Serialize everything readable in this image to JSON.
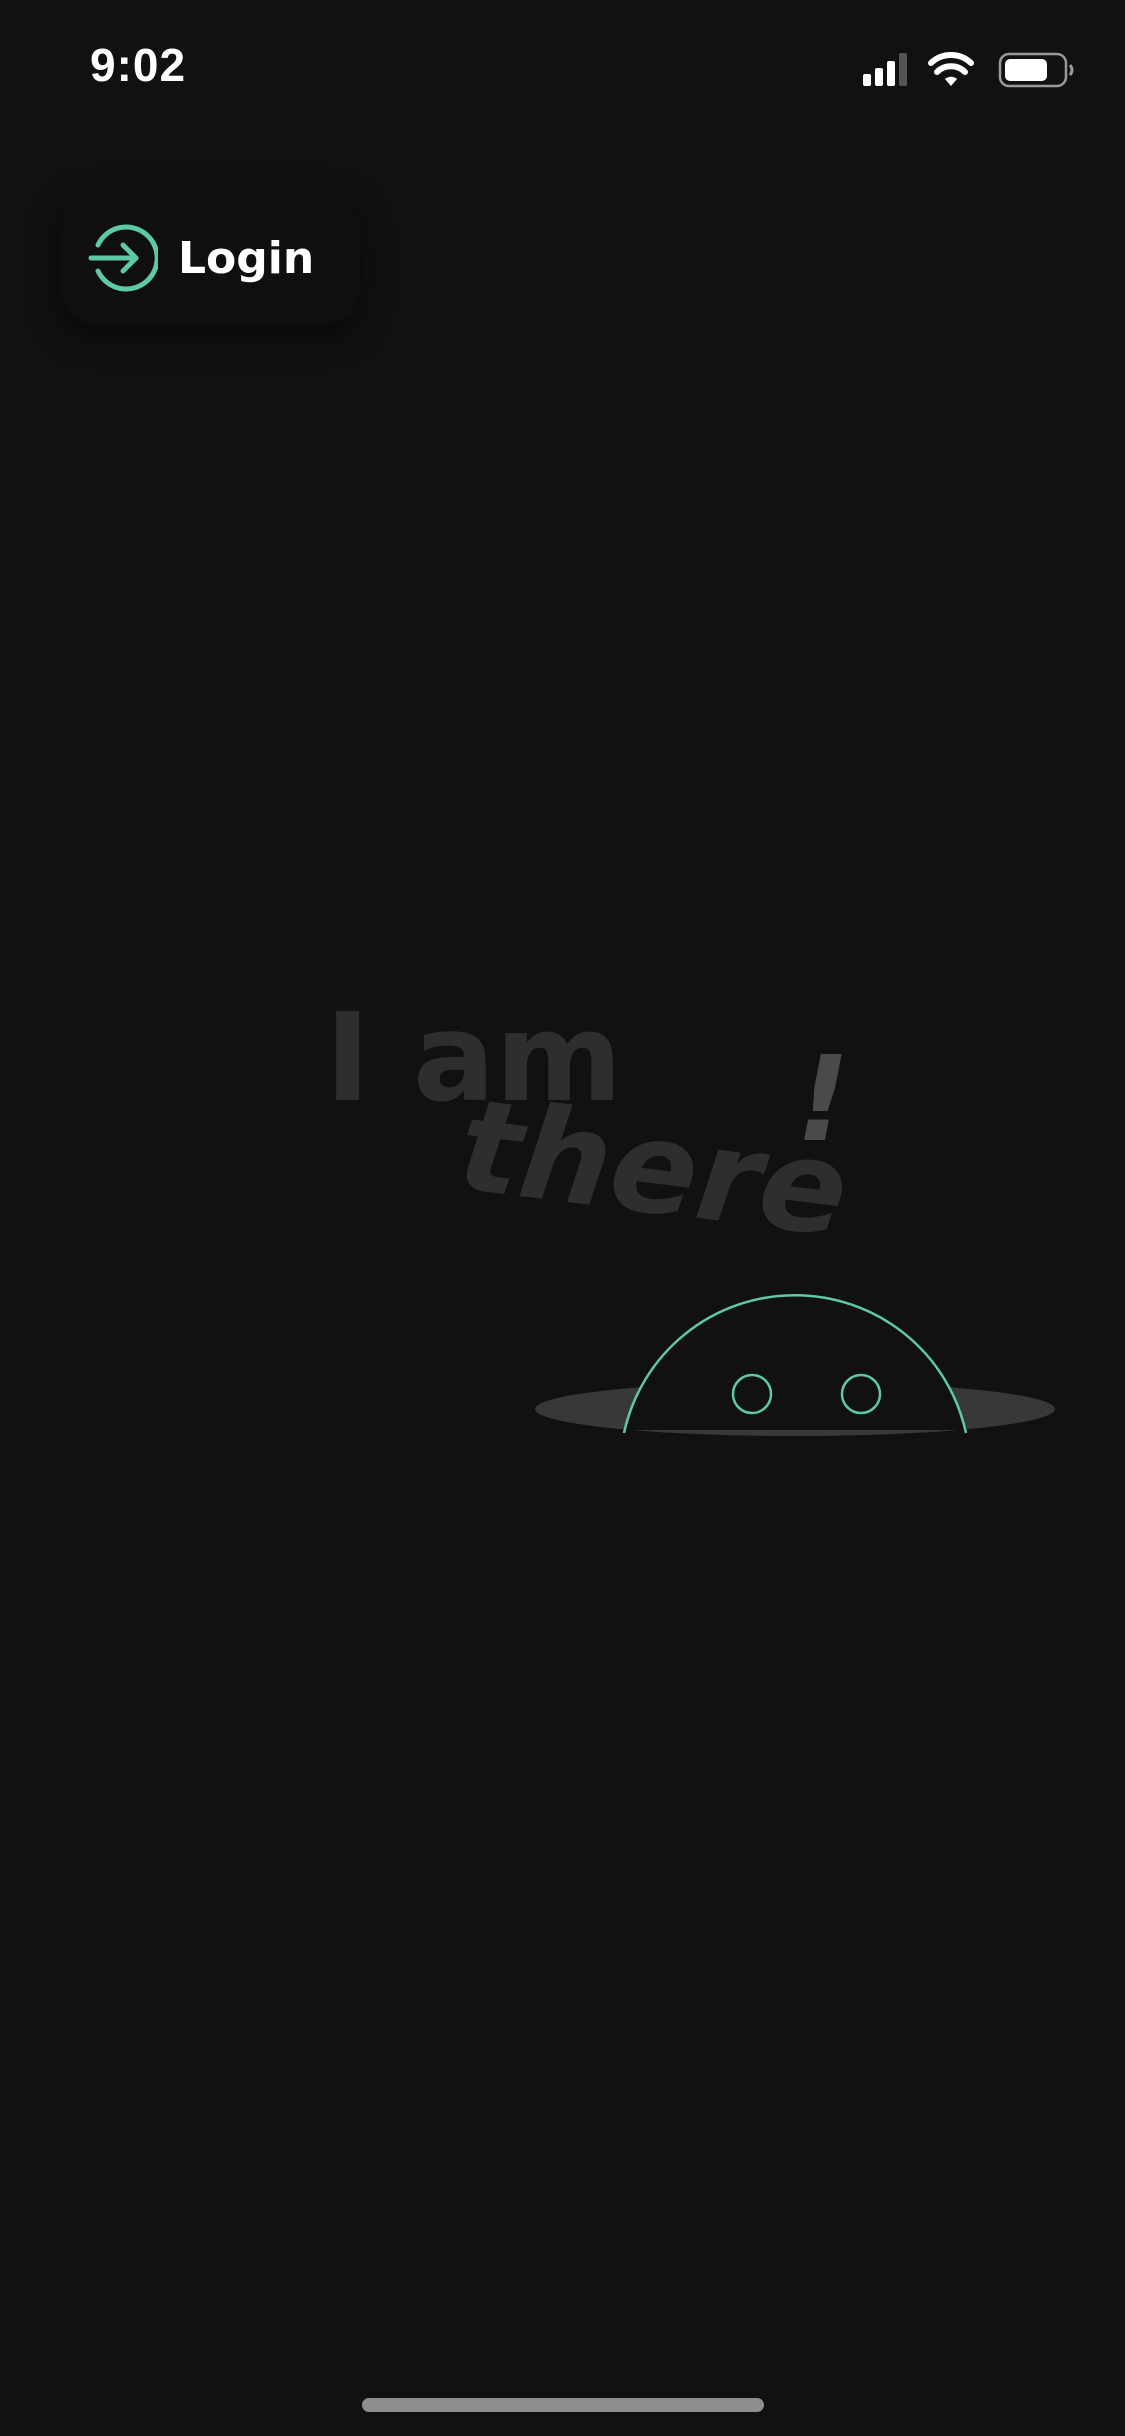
{
  "status_bar": {
    "time": "9:02",
    "icons": [
      "cellular-signal-icon",
      "wifi-icon",
      "battery-icon"
    ]
  },
  "login": {
    "label": "Login",
    "icon": "login-arrow-icon",
    "accent_color": "#5ec9a7"
  },
  "illustration": {
    "line1": "I am",
    "line2": "there",
    "exclamation": "!",
    "character": "peeking-creature",
    "text_color": "#2e2e2e",
    "exclamation_color": "#4a4a4a",
    "hole_color": "#383838",
    "outline_color": "#5ec9a7"
  },
  "colors": {
    "background": "#111111",
    "home_indicator": "#8e8e8e"
  }
}
